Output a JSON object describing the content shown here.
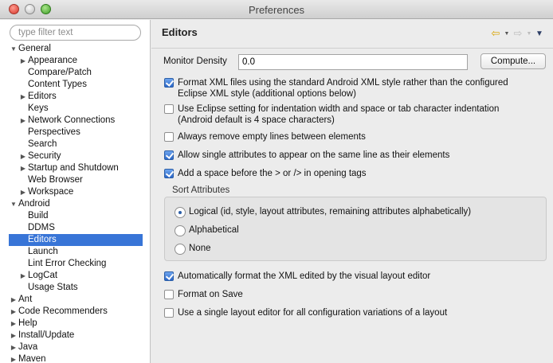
{
  "window": {
    "title": "Preferences"
  },
  "sidebar": {
    "filter_placeholder": "type filter text",
    "tree": [
      {
        "label": "General",
        "level": 0,
        "expand": "open"
      },
      {
        "label": "Appearance",
        "level": 1,
        "expand": "closed"
      },
      {
        "label": "Compare/Patch",
        "level": 1,
        "expand": "none"
      },
      {
        "label": "Content Types",
        "level": 1,
        "expand": "none"
      },
      {
        "label": "Editors",
        "level": 1,
        "expand": "closed"
      },
      {
        "label": "Keys",
        "level": 1,
        "expand": "none"
      },
      {
        "label": "Network Connections",
        "level": 1,
        "expand": "closed"
      },
      {
        "label": "Perspectives",
        "level": 1,
        "expand": "none"
      },
      {
        "label": "Search",
        "level": 1,
        "expand": "none"
      },
      {
        "label": "Security",
        "level": 1,
        "expand": "closed"
      },
      {
        "label": "Startup and Shutdown",
        "level": 1,
        "expand": "closed"
      },
      {
        "label": "Web Browser",
        "level": 1,
        "expand": "none"
      },
      {
        "label": "Workspace",
        "level": 1,
        "expand": "closed"
      },
      {
        "label": "Android",
        "level": 0,
        "expand": "open"
      },
      {
        "label": "Build",
        "level": 1,
        "expand": "none"
      },
      {
        "label": "DDMS",
        "level": 1,
        "expand": "none"
      },
      {
        "label": "Editors",
        "level": 1,
        "expand": "none",
        "selected": true
      },
      {
        "label": "Launch",
        "level": 1,
        "expand": "none"
      },
      {
        "label": "Lint Error Checking",
        "level": 1,
        "expand": "none"
      },
      {
        "label": "LogCat",
        "level": 1,
        "expand": "closed"
      },
      {
        "label": "Usage Stats",
        "level": 1,
        "expand": "none"
      },
      {
        "label": "Ant",
        "level": 0,
        "expand": "closed"
      },
      {
        "label": "Code Recommenders",
        "level": 0,
        "expand": "closed"
      },
      {
        "label": "Help",
        "level": 0,
        "expand": "closed"
      },
      {
        "label": "Install/Update",
        "level": 0,
        "expand": "closed"
      },
      {
        "label": "Java",
        "level": 0,
        "expand": "closed"
      },
      {
        "label": "Maven",
        "level": 0,
        "expand": "closed"
      }
    ]
  },
  "main": {
    "title": "Editors",
    "monitor_density": {
      "label": "Monitor Density",
      "value": "0.0",
      "button": "Compute..."
    },
    "options_top": [
      {
        "text": "Format XML files using the standard Android XML style rather than the configured Eclipse XML style (additional options below)",
        "checked": true
      },
      {
        "text": "Use Eclipse setting for indentation width and space or tab character indentation (Android default is 4 space characters)",
        "checked": false
      },
      {
        "text": "Always remove empty lines between elements",
        "checked": false
      },
      {
        "text": "Allow single attributes to appear on the same line as their elements",
        "checked": true
      },
      {
        "text": "Add a space before the > or /> in opening tags",
        "checked": true
      }
    ],
    "sort_attributes": {
      "label": "Sort Attributes",
      "options": [
        {
          "text": "Logical (id, style, layout attributes, remaining attributes alphabetically)",
          "selected": true
        },
        {
          "text": "Alphabetical",
          "selected": false
        },
        {
          "text": "None",
          "selected": false
        }
      ]
    },
    "options_bottom": [
      {
        "text": "Automatically format the XML edited by the visual layout editor",
        "checked": true
      },
      {
        "text": "Format on Save",
        "checked": false
      },
      {
        "text": "Use a single layout editor for all configuration variations of a layout",
        "checked": false
      }
    ]
  },
  "colors": {
    "selection": "#3875d7",
    "accent": "#2a66c8"
  },
  "icons": {
    "back": "back-arrow-icon",
    "forward": "forward-arrow-icon",
    "menu": "view-menu-icon"
  }
}
